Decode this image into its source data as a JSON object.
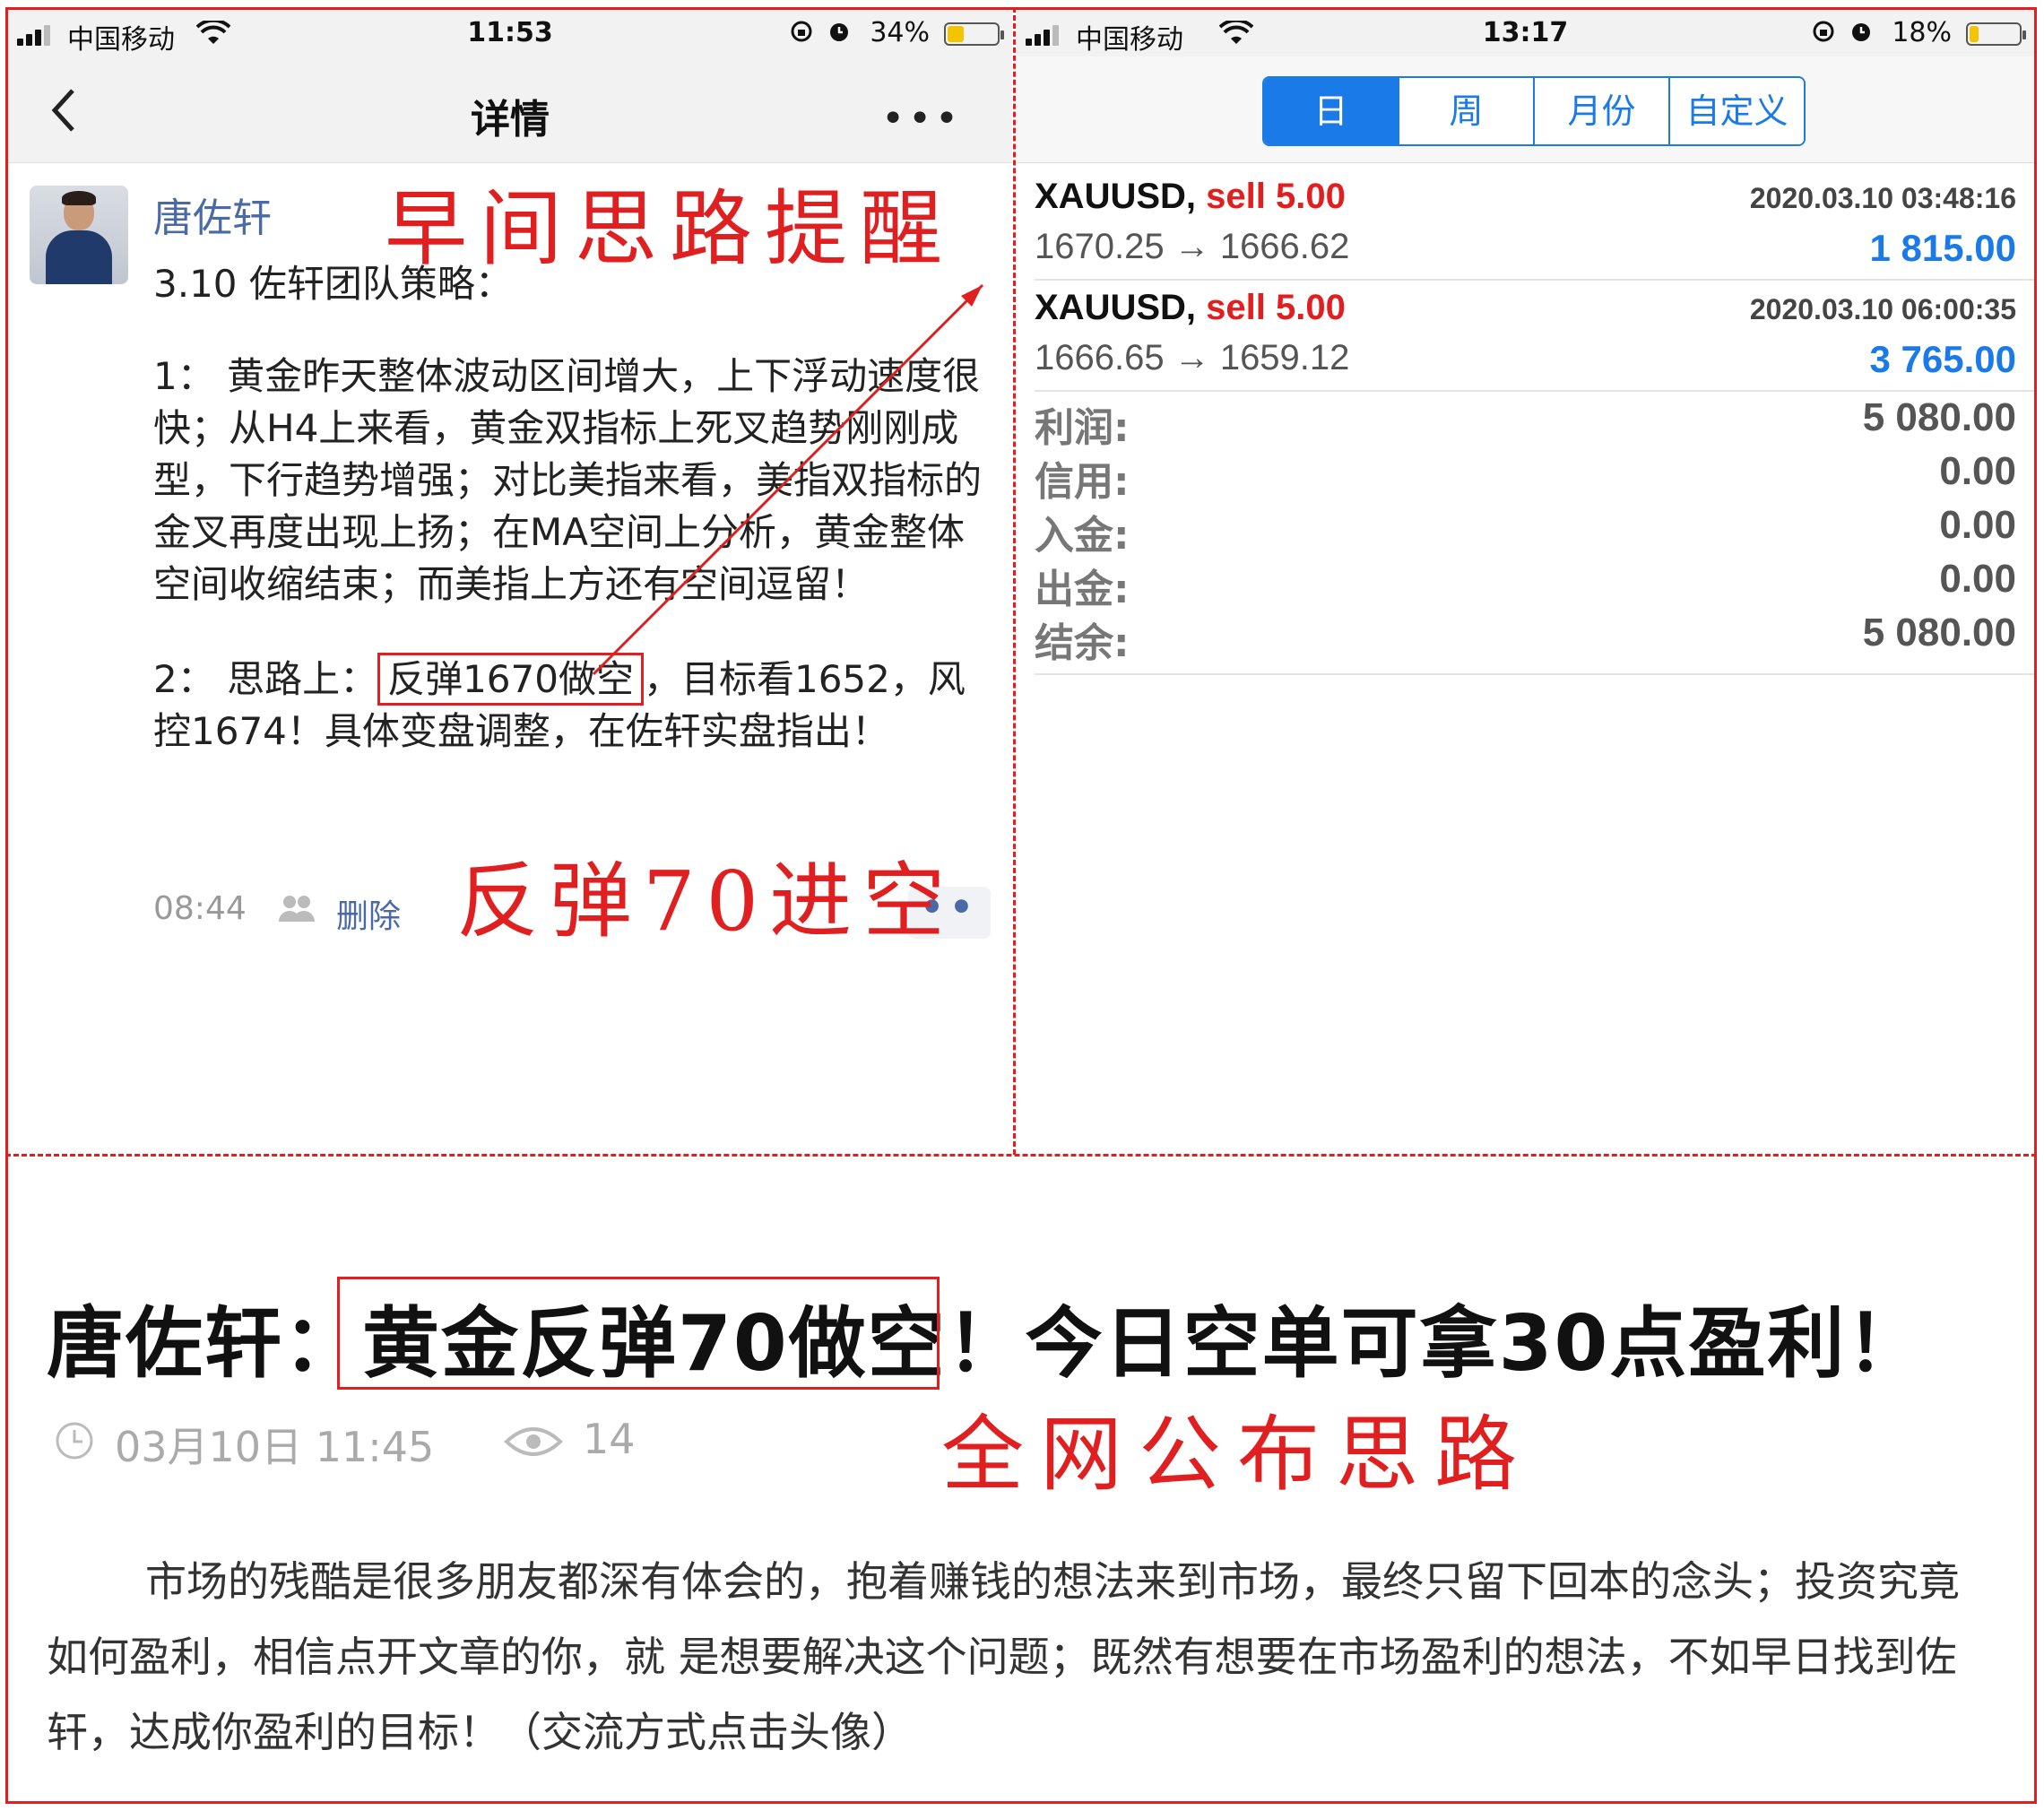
{
  "left_phone": {
    "status": {
      "carrier": "中国移动",
      "time": "11:53",
      "battery": "34%"
    },
    "nav": {
      "title": "详情",
      "more": "•••"
    },
    "post": {
      "username": "唐佐轩",
      "heading": "3.10 佐轩团队策略：",
      "para1": "1： 黄金昨天整体波动区间增大，上下浮动速度很快；从H4上来看，黄金双指标上死叉趋势刚刚成型，下行趋势增强；对比美指来看，美指双指标的金叉再度出现上扬；在MA空间上分析，黄金整体空间收缩结束；而美指上方还有空间逗留！",
      "para2_prefix": "2： 思路上：",
      "para2_highlight": "反弹1670做空",
      "para2_suffix": "，目标看1652，风控1674！具体变盘调整，在佐轩实盘指出！",
      "time": "08:44",
      "delete": "删除",
      "comment": "••"
    },
    "annotations": {
      "morning": "早间思路提醒",
      "rebound": "反弹70进空"
    }
  },
  "right_phone": {
    "status": {
      "carrier": "中国移动",
      "time": "13:17",
      "battery": "18%"
    },
    "tabs": [
      "日",
      "周",
      "月份",
      "自定义"
    ],
    "active_tab": "日",
    "trades": [
      {
        "symbol": "XAUUSD,",
        "side": "sell 5.00",
        "date": "2020.03.10 03:48:16",
        "prices": "1670.25 → 1666.62",
        "profit": "1 815.00"
      },
      {
        "symbol": "XAUUSD,",
        "side": "sell 5.00",
        "date": "2020.03.10 06:00:35",
        "prices": "1666.65 → 1659.12",
        "profit": "3 765.00"
      }
    ],
    "summary": [
      {
        "label": "利润:",
        "value": "5 080.00"
      },
      {
        "label": "信用:",
        "value": "0.00"
      },
      {
        "label": "入金:",
        "value": "0.00"
      },
      {
        "label": "出金:",
        "value": "0.00"
      },
      {
        "label": "结余:",
        "value": "5 080.00"
      }
    ]
  },
  "article": {
    "title": "唐佐轩：黄金反弹70做空！今日空单可拿30点盈利！",
    "date": "03月10日  11:45",
    "views": "14",
    "annotation": "全网公布思路",
    "body": "市场的残酷是很多朋友都深有体会的，抱着赚钱的想法来到市场，最终只留下回本的念头；投资究竟如何盈利，相信点开文章的你，就 是想要解决这个问题；既然有想要在市场盈利的想法，不如早日找到佐轩，达成你盈利的目标！（交流方式点击头像）"
  },
  "colors": {
    "accent_red": "#e02020",
    "link_blue": "#4a6aa5",
    "tab_blue": "#1a7ae8"
  }
}
